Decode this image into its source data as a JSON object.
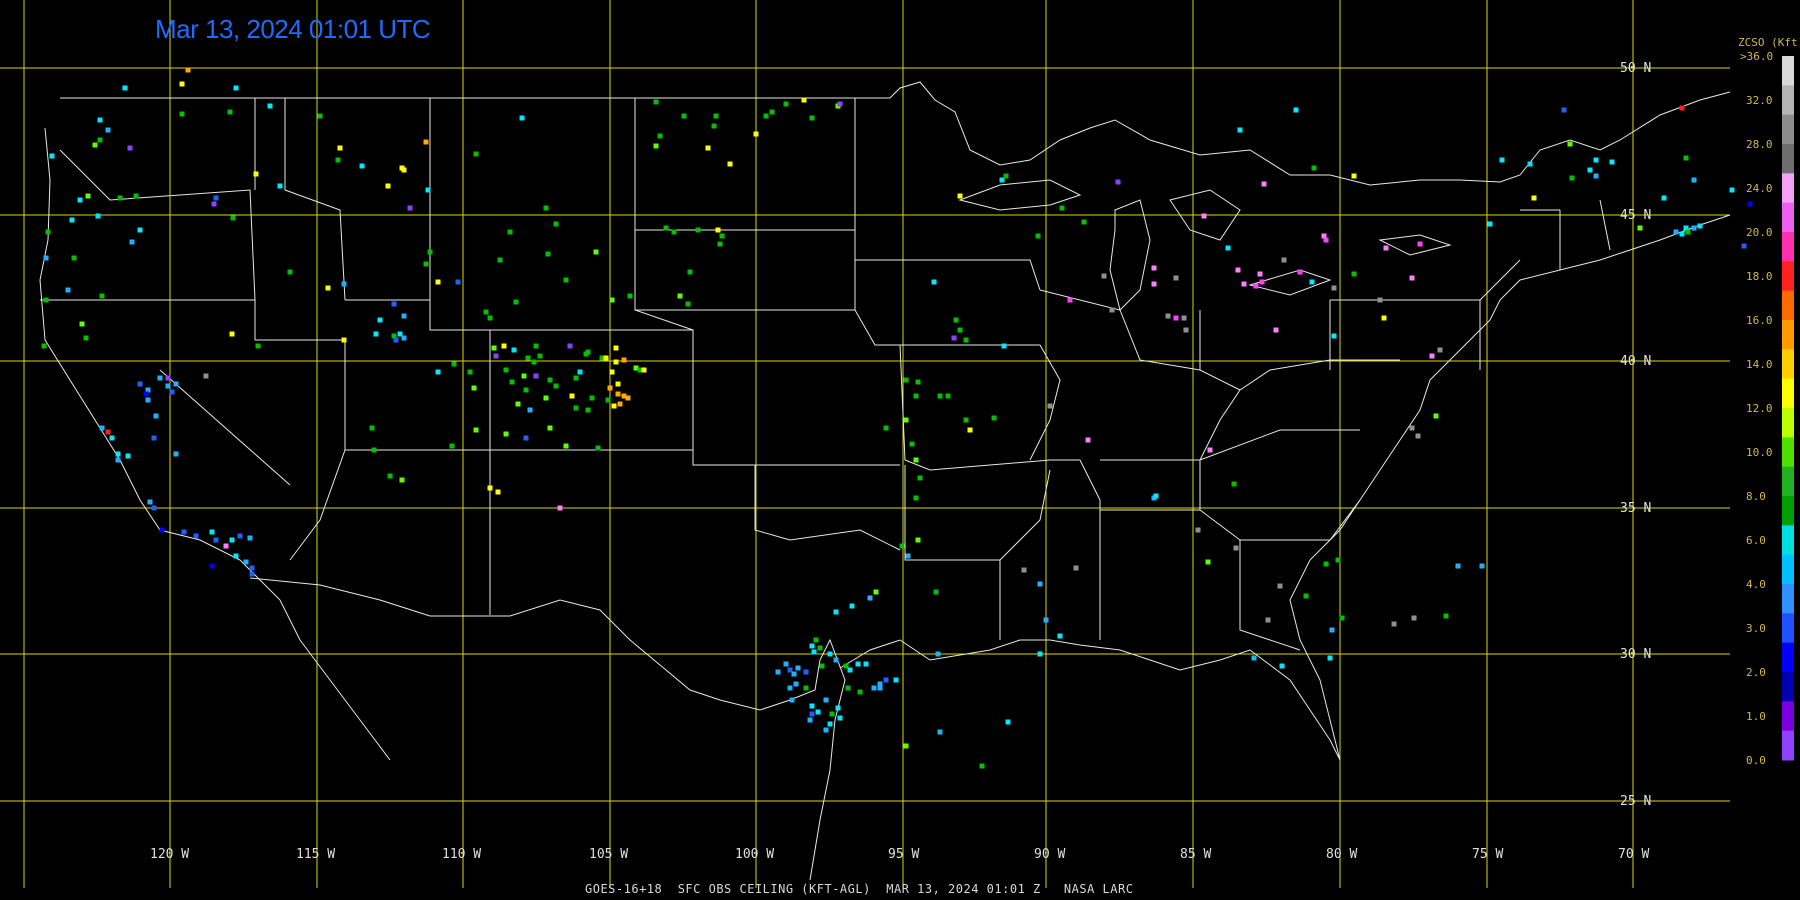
{
  "header": {
    "timestamp": "Mar 13, 2024 01:01 UTC"
  },
  "footer": {
    "caption": "GOES-16+18  SFC OBS CEILING (KFT-AGL)  MAR 13, 2024 01:01 Z   NASA LARC"
  },
  "map": {
    "lat_labels": [
      "50 N",
      "45 N",
      "40 N",
      "35 N",
      "30 N",
      "25 N"
    ],
    "lon_labels": [
      "120 W",
      "115 W",
      "110 W",
      "105 W",
      "100 W",
      "95 W",
      "90 W",
      "85 W",
      "80 W",
      "75 W",
      "70 W"
    ],
    "grid_color": "#d8d800",
    "border_color": "#e8e8e8"
  },
  "colorbar": {
    "title": "ZCSO (Kft)",
    "top_label": ">36.0",
    "labels": [
      "32.0",
      "28.0",
      "24.0",
      "20.0",
      "18.0",
      "16.0",
      "14.0",
      "12.0",
      "10.0",
      "8.0",
      "6.0",
      "4.0",
      "3.0",
      "2.0",
      "1.0",
      "0.0"
    ],
    "colors": [
      "#d8d8d8",
      "#b4b4b4",
      "#8c8c8c",
      "#6e6e6e",
      "#f4a0f4",
      "#f060f0",
      "#ff30b0",
      "#ff2020",
      "#ff6a00",
      "#ff9a00",
      "#ffd000",
      "#ffff00",
      "#bcff00",
      "#50e000",
      "#20b020",
      "#00a000",
      "#00e0e0",
      "#00c0ff",
      "#3090ff",
      "#2050ff",
      "#0000ff",
      "#0000b0",
      "#7a00e0",
      "#9040ff"
    ]
  },
  "obs_colors": {
    "purple": "#9040ff",
    "dkblue": "#0000ff",
    "blue": "#2060ff",
    "ltblue": "#20b0ff",
    "cyan": "#00e8ff",
    "green": "#00c000",
    "ltgreen": "#60ff00",
    "yellow": "#ffff00",
    "orange": "#ffaa00",
    "red": "#ff2020",
    "pink": "#ff80ff",
    "magenta": "#ff40ff",
    "gray": "#909090"
  }
}
